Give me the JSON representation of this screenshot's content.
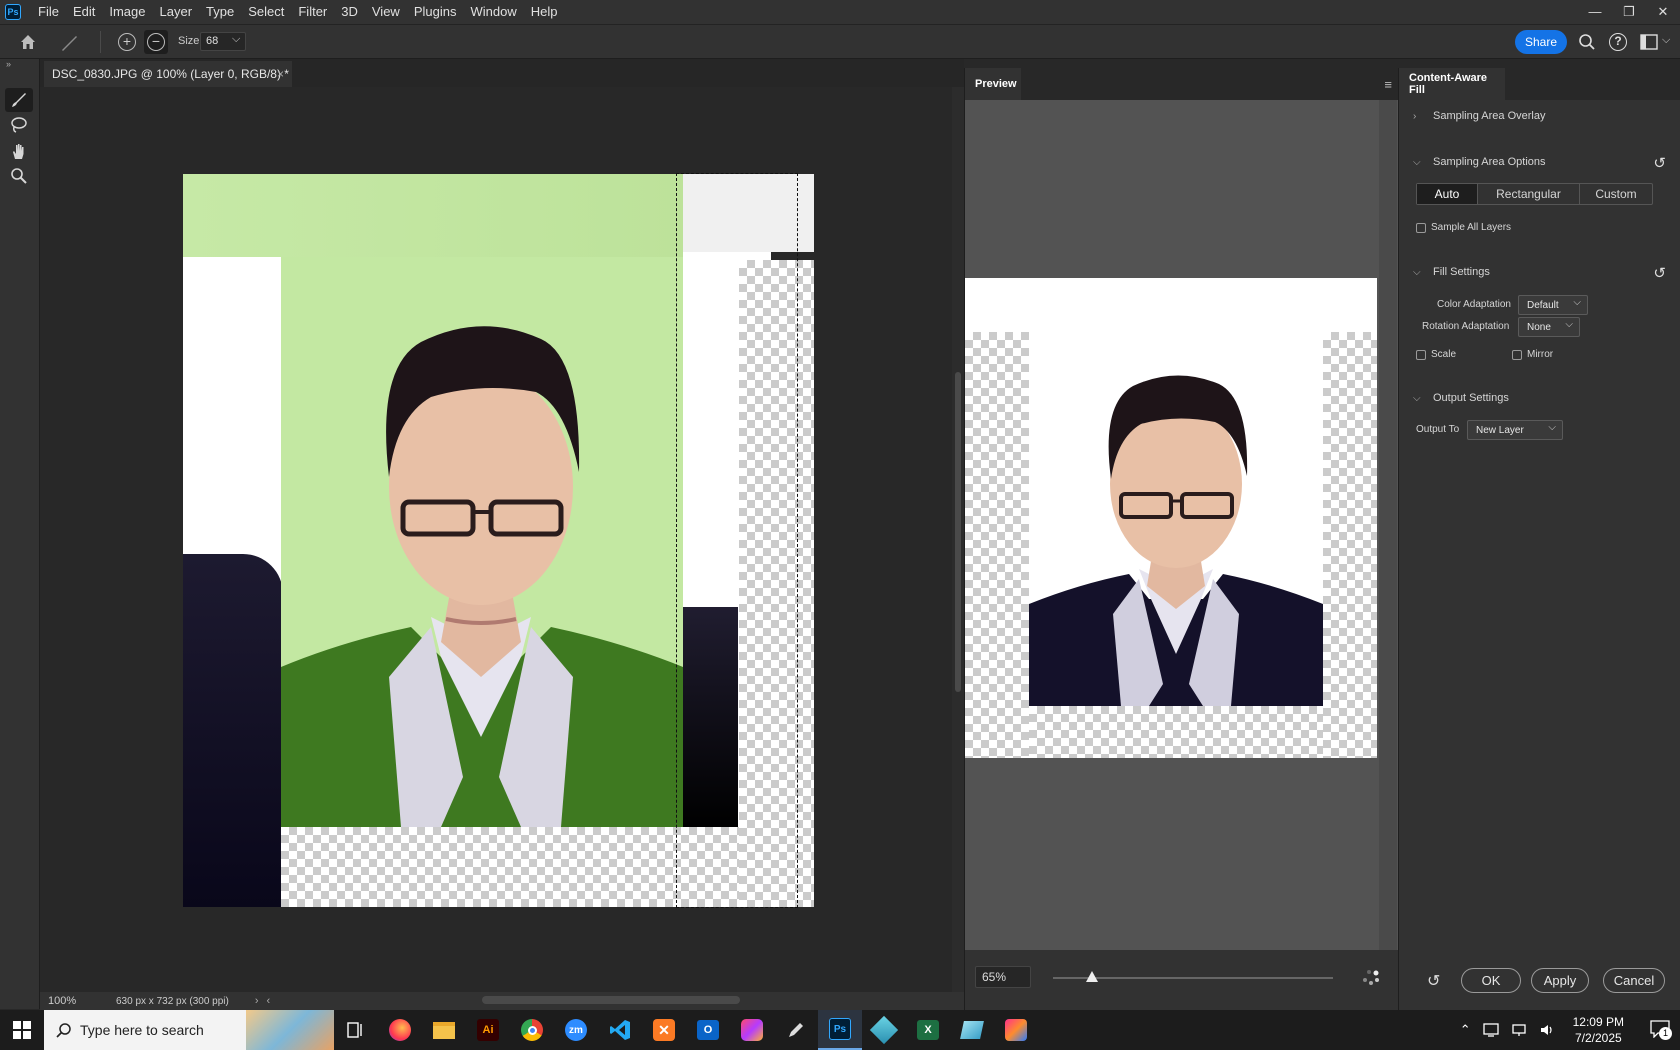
{
  "app": {
    "logo": "Ps"
  },
  "menu": [
    "File",
    "Edit",
    "Image",
    "Layer",
    "Type",
    "Select",
    "Filter",
    "3D",
    "View",
    "Plugins",
    "Window",
    "Help"
  ],
  "window_controls": {
    "minimize": "—",
    "restore": "❐",
    "close": "✕"
  },
  "options": {
    "size_label": "Size",
    "size_value": "68",
    "share_label": "Share"
  },
  "document": {
    "tab_title": "DSC_0830.JPG @ 100% (Layer 0, RGB/8) *",
    "close": "×"
  },
  "status": {
    "zoom": "100%",
    "dimensions": "630 px x 732 px (300 ppi)"
  },
  "preview": {
    "tab_label": "Preview",
    "zoom": "65%",
    "zoom_level": 0.14
  },
  "caf": {
    "tab_label": "Content-Aware Fill",
    "sampling_overlay": "Sampling Area Overlay",
    "sampling_options": "Sampling Area Options",
    "sampling_buttons": [
      "Auto",
      "Rectangular",
      "Custom"
    ],
    "sample_all_layers": "Sample All Layers",
    "fill_settings": "Fill Settings",
    "color_adaptation_label": "Color Adaptation",
    "color_adaptation_value": "Default",
    "rotation_adaptation_label": "Rotation Adaptation",
    "rotation_adaptation_value": "None",
    "scale_label": "Scale",
    "mirror_label": "Mirror",
    "output_settings": "Output Settings",
    "output_to_label": "Output To",
    "output_to_value": "New Layer",
    "ok": "OK",
    "apply": "Apply",
    "cancel": "Cancel"
  },
  "taskbar": {
    "search_placeholder": "Type here to search",
    "time": "12:09 PM",
    "date": "7/2/2025",
    "notification_count": "1",
    "apps": [
      "Ai",
      "zm"
    ]
  },
  "colors": {
    "accent": "#1473e6",
    "green_bg": "#c3e8a2",
    "jacket_green": "#3f7a1e"
  }
}
